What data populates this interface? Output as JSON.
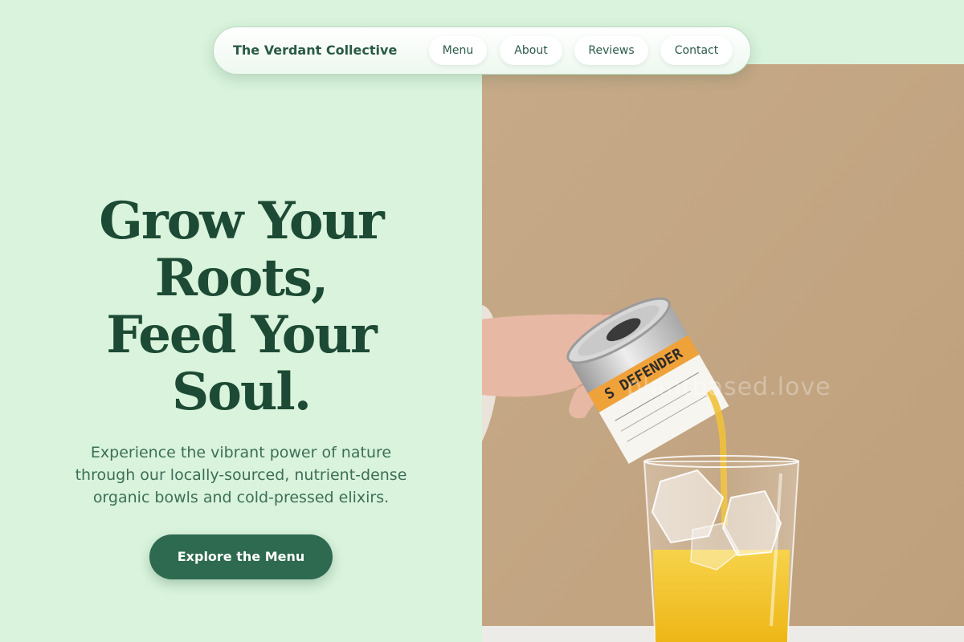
{
  "nav": {
    "brand": "The Verdant Collective",
    "links": [
      {
        "label": "Menu"
      },
      {
        "label": "About"
      },
      {
        "label": "Reviews"
      },
      {
        "label": "Contact"
      }
    ]
  },
  "hero": {
    "headline_lines": [
      "Grow Your",
      "Roots,",
      "Feed Your",
      "Soul."
    ],
    "subtext": "Experience the vibrant power of nature through our locally-sourced, nutrient-dense organic bowls and cold-pressed elixirs.",
    "cta_label": "Explore the Menu"
  },
  "image": {
    "watermark": "plantbased.love",
    "can_label": "S DEFENDER"
  },
  "colors": {
    "page_bg": "#d9f3dc",
    "primary_green": "#2d6a4f",
    "heading_green": "#1d4a34",
    "photo_bg": "#c4a886",
    "juice": "#f2c21f"
  }
}
